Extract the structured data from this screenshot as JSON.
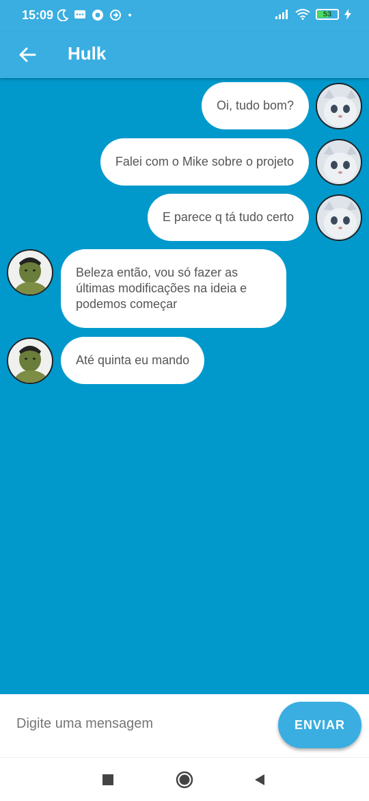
{
  "status_bar": {
    "time": "15:09",
    "battery": "53"
  },
  "header": {
    "title": "Hulk"
  },
  "messages": [
    {
      "text": "Oi, tudo bom?",
      "sender": "me"
    },
    {
      "text": "Falei com o Mike sobre o projeto",
      "sender": "me"
    },
    {
      "text": "E parece q tá tudo certo",
      "sender": "me"
    },
    {
      "text": "Beleza então, vou só fazer as últimas modificações na ideia e podemos começar",
      "sender": "contact"
    },
    {
      "text": "Até quinta eu mando",
      "sender": "contact"
    }
  ],
  "composer": {
    "placeholder": "Digite uma mensagem",
    "send_label": "ENVIAR"
  },
  "colors": {
    "primary": "#3aaee0",
    "chat_background": "#0199cc",
    "bubble": "#ffffff"
  },
  "icons": {
    "back": "arrow-left-icon",
    "nav_recent": "square-icon",
    "nav_home": "circle-icon",
    "nav_back": "triangle-icon"
  }
}
